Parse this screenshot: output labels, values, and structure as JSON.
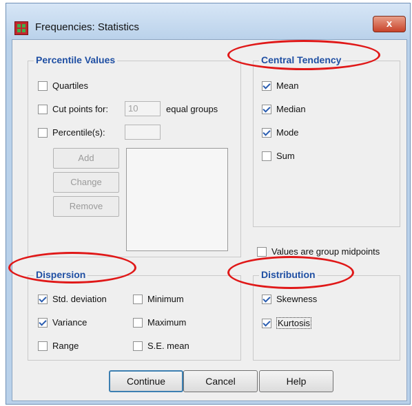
{
  "window": {
    "title": "Frequencies: Statistics",
    "close_label": "x"
  },
  "percentile_values": {
    "legend": "Percentile Values",
    "quartiles": {
      "label": "Quartiles",
      "checked": false
    },
    "cut_points": {
      "label": "Cut points for:",
      "value": "10",
      "suffix": "equal groups",
      "checked": false
    },
    "percentiles": {
      "label": "Percentile(s):",
      "value": "",
      "checked": false
    },
    "buttons": {
      "add": "Add",
      "change": "Change",
      "remove": "Remove"
    }
  },
  "central_tendency": {
    "legend": "Central Tendency",
    "items": [
      {
        "label": "Mean",
        "checked": true
      },
      {
        "label": "Median",
        "checked": true
      },
      {
        "label": "Mode",
        "checked": true
      },
      {
        "label": "Sum",
        "checked": false
      }
    ]
  },
  "group_midpoints": {
    "label": "Values are group midpoints",
    "checked": false
  },
  "dispersion": {
    "legend": "Dispersion",
    "items": [
      {
        "label": "Std. deviation",
        "checked": true
      },
      {
        "label": "Variance",
        "checked": true
      },
      {
        "label": "Range",
        "checked": false
      },
      {
        "label": "Minimum",
        "checked": false
      },
      {
        "label": "Maximum",
        "checked": false
      },
      {
        "label": "S.E. mean",
        "checked": false
      }
    ]
  },
  "distribution": {
    "legend": "Distribution",
    "items": [
      {
        "label": "Skewness",
        "checked": true
      },
      {
        "label": "Kurtosis",
        "checked": true
      }
    ]
  },
  "buttons": {
    "continue": "Continue",
    "cancel": "Cancel",
    "help": "Help"
  },
  "annotation_color": "#e01818"
}
